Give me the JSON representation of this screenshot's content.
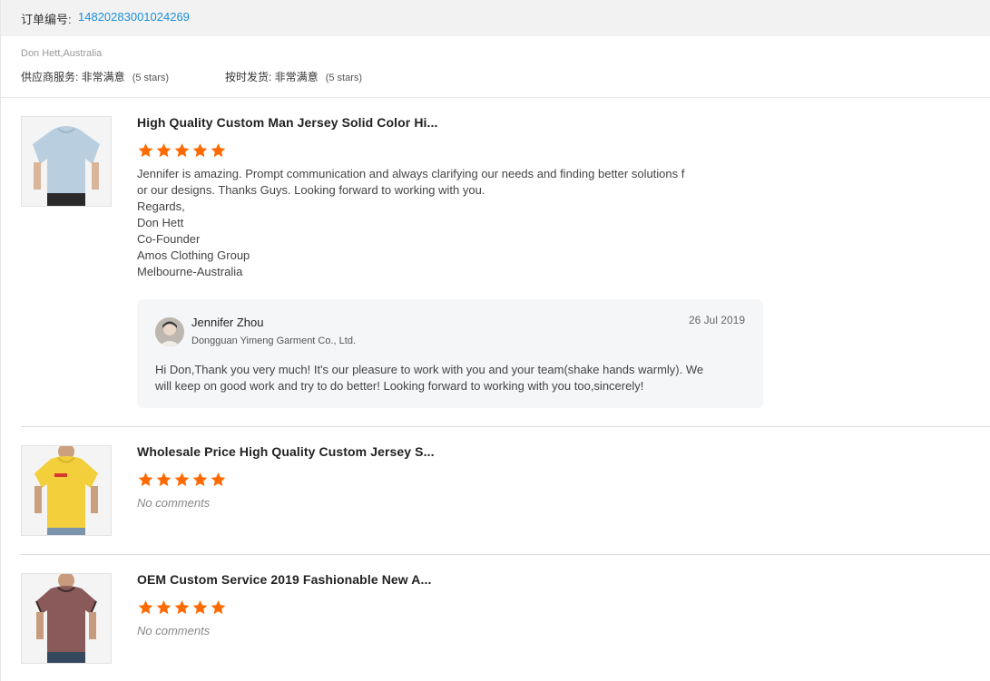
{
  "order": {
    "label": "订单编号: ",
    "number": "14820283001024269"
  },
  "buyer": {
    "name": "Don Hett,Australia"
  },
  "ratings": [
    {
      "label": "供应商服务: ",
      "value": "非常满意",
      "stars": "(5 stars)"
    },
    {
      "label": "按时发货: ",
      "value": "非常满意",
      "stars": "(5 stars)"
    }
  ],
  "colors": {
    "star": "#ff6a00",
    "link": "#1a8fd6"
  },
  "reviews": [
    {
      "product_title": "High Quality Custom Man Jersey Solid Color Hi...",
      "rating": 5,
      "thumb_icon": "light-blue-tshirt",
      "comment_lines": [
        "Jennifer is amazing. Prompt communication and always clarifying our needs and finding better solutions f",
        "or our designs. Thanks Guys. Looking forward to working with you.",
        "Regards,",
        "Don Hett",
        "Co-Founder",
        "Amos Clothing Group",
        "Melbourne-Australia"
      ],
      "reply": {
        "name": "Jennifer Zhou",
        "company": "Dongguan Yimeng Garment Co., Ltd.",
        "date": "26 Jul 2019",
        "text_lines": [
          "Hi Don,Thank you very much! It's our pleasure to work with you and your team(shake hands warmly). We",
          "will keep on good work and try to do better! Looking forward to working with you too,sincerely!"
        ]
      }
    },
    {
      "product_title": "Wholesale Price High Quality Custom Jersey S...",
      "rating": 5,
      "thumb_icon": "yellow-tshirt",
      "comment": "No comments"
    },
    {
      "product_title": "OEM Custom Service 2019 Fashionable New A...",
      "rating": 5,
      "thumb_icon": "maroon-ringer-tshirt",
      "comment": "No comments"
    }
  ]
}
